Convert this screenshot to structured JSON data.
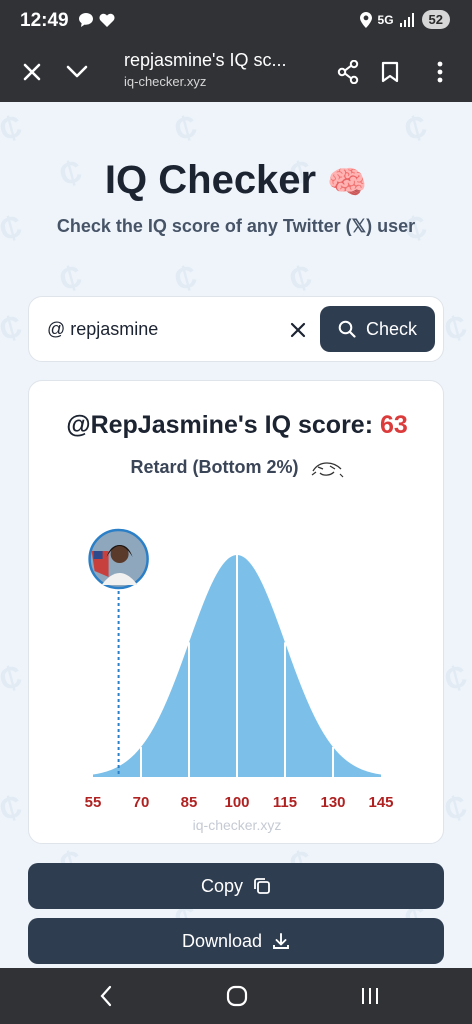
{
  "status_bar": {
    "time": "12:49",
    "network": "5G",
    "battery": "52"
  },
  "browser": {
    "title": "repjasmine's IQ sc...",
    "url": "iq-checker.xyz"
  },
  "page": {
    "heading": "IQ Checker",
    "heading_emoji": "🧠",
    "subtitle": "Check the IQ score of any Twitter (𝕏) user"
  },
  "search": {
    "value": "@ repjasmine",
    "check_label": "Check"
  },
  "result": {
    "handle_prefix": "@RepJasmine's IQ score: ",
    "score": "63",
    "percentile_label": "Retard (Bottom 2%)"
  },
  "chart_data": {
    "type": "area",
    "description": "Normal distribution of IQ, mean 100, sd 15",
    "x_ticks": [
      "55",
      "70",
      "85",
      "100",
      "115",
      "130",
      "145"
    ],
    "mean": 100,
    "sd": 15,
    "xlim": [
      55,
      145
    ],
    "marker_value": 63,
    "fill_color": "#7cc0ea",
    "marker_color": "#2b7fc7",
    "tick_label_color": "#b02222"
  },
  "footer_watermark": "iq-checker.xyz",
  "actions": {
    "copy_label": "Copy",
    "download_label": "Download"
  },
  "colors": {
    "button_bg": "#2f3d51",
    "score_red": "#dc3b3b",
    "page_bg": "#eef4fa"
  }
}
